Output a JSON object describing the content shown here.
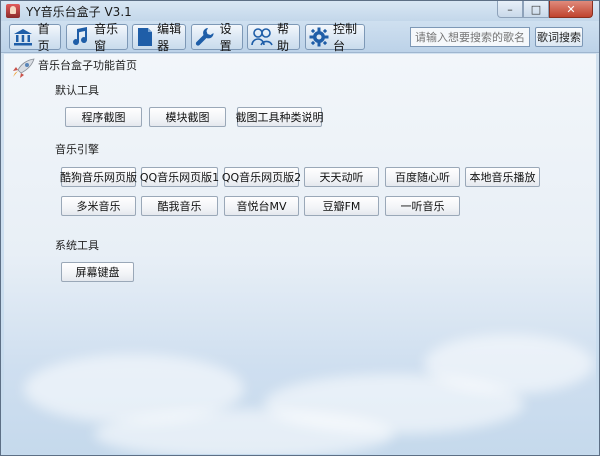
{
  "window": {
    "title": "YY音乐台盒子 V3.1",
    "minimize": "–",
    "maximize": "□",
    "close": "✕"
  },
  "toolbar": {
    "items": [
      {
        "label": "首页",
        "icon": "bank-icon"
      },
      {
        "label": "音乐窗",
        "icon": "music-note-icon"
      },
      {
        "label": "编辑器",
        "icon": "document-icon"
      },
      {
        "label": "设置",
        "icon": "wrench-icon"
      },
      {
        "label": "帮助",
        "icon": "users-icon"
      },
      {
        "label": "控制台",
        "icon": "gear-icon"
      }
    ],
    "search_placeholder": "请输入想要搜索的歌名",
    "search_button": "歌词搜索"
  },
  "page": {
    "title": "音乐台盒子功能首页",
    "icon": "rocket-icon"
  },
  "sections": {
    "default_tools": {
      "label": "默认工具",
      "buttons": [
        "程序截图",
        "模块截图",
        "截图工具种类说明"
      ]
    },
    "music_engines": {
      "label": "音乐引擎",
      "row1": [
        "酷狗音乐网页版",
        "QQ音乐网页版1",
        "QQ音乐网页版2",
        "天天动听",
        "百度随心听",
        "本地音乐播放"
      ],
      "row2": [
        "多米音乐",
        "酷我音乐",
        "音悦台MV",
        "豆瓣FM",
        "一听音乐"
      ]
    },
    "system_tools": {
      "label": "系统工具",
      "buttons": [
        "屏幕键盘"
      ]
    }
  }
}
